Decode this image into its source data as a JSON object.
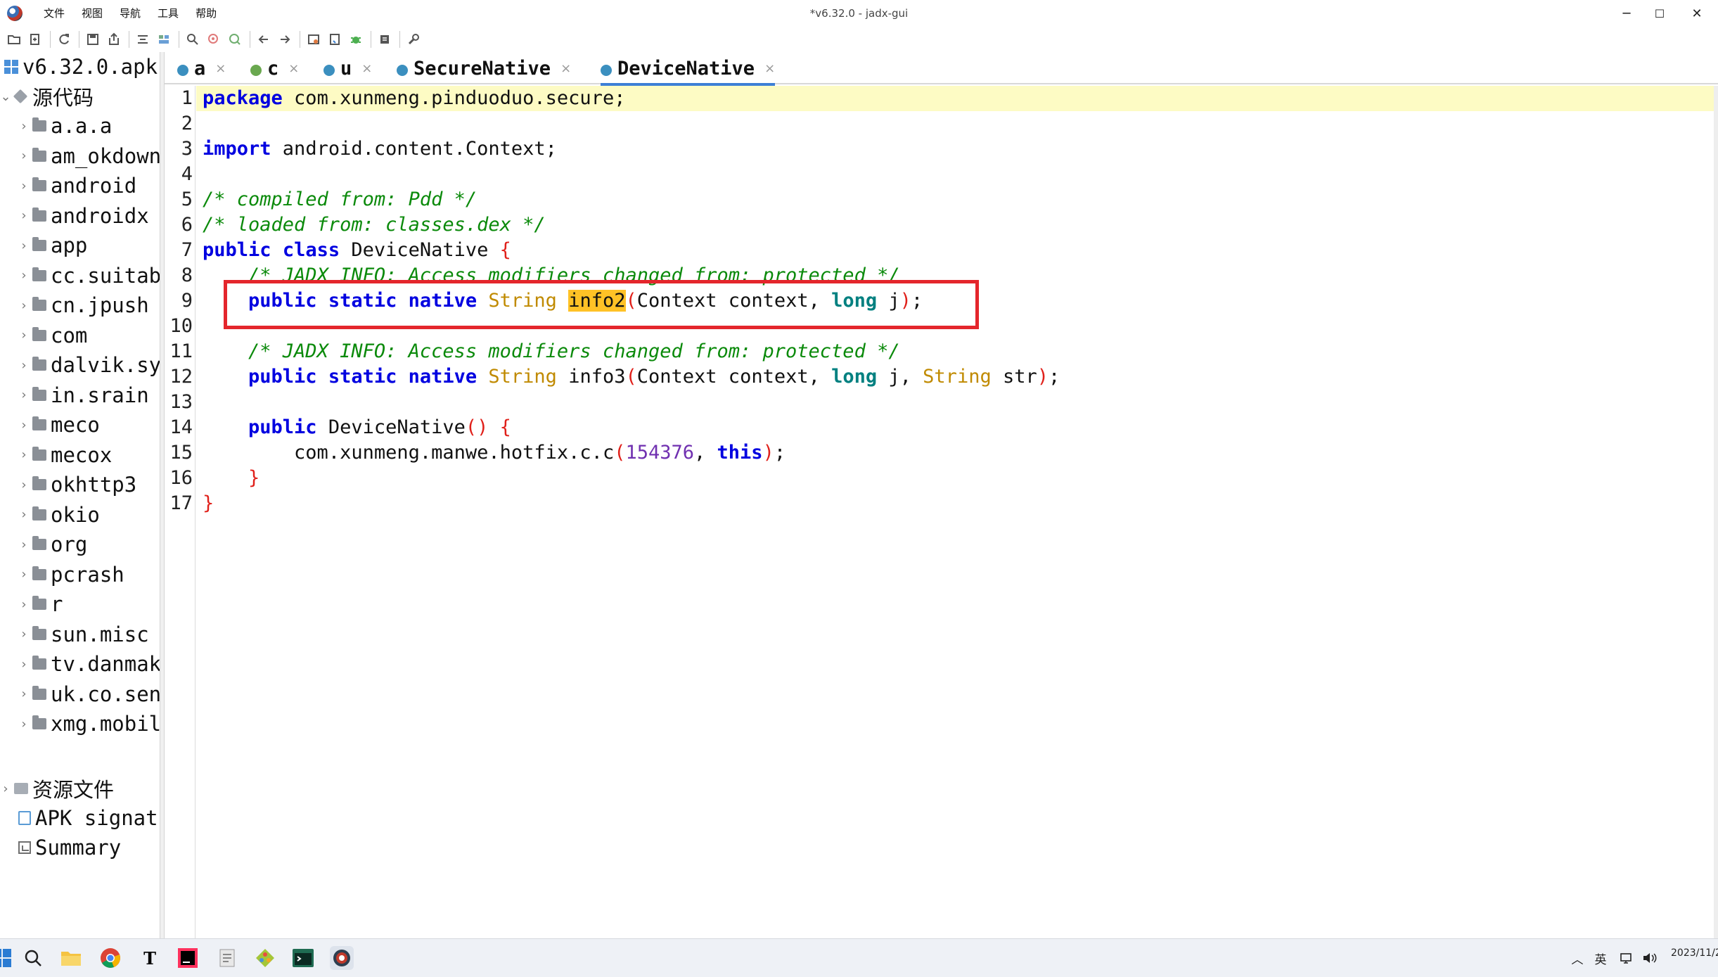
{
  "window": {
    "title": "*v6.32.0 - jadx-gui",
    "minimize": "─",
    "maximize": "☐",
    "close": "✕"
  },
  "menu": [
    "文件",
    "视图",
    "导航",
    "工具",
    "帮助"
  ],
  "toolbar_icons": [
    "open-file-icon",
    "add-files-icon",
    "reload-icon",
    "save-all-icon",
    "export-icon",
    "sync-tree-icon",
    "flat-packages-icon",
    "search-icon",
    "find-usage-icon",
    "goto-icon",
    "back-icon",
    "forward-icon",
    "deobfuscation-icon",
    "quark-icon",
    "debug-icon",
    "log-viewer-icon",
    "preferences-icon"
  ],
  "tree": {
    "root": "v6.32.0.apk",
    "source_node": "源代码",
    "packages": [
      "a.a.a",
      "am_okdown",
      "android",
      "androidx",
      "app",
      "cc.suitab",
      "cn.jpush",
      "com",
      "dalvik.sy",
      "in.srain",
      "meco",
      "mecox",
      "okhttp3",
      "okio",
      "org",
      "pcrash",
      "r",
      "sun.misc",
      "tv.danmak",
      "uk.co.sen",
      "xmg.mobil"
    ],
    "resources_node": "资源文件",
    "apk_signature": "APK signat",
    "summary": "Summary"
  },
  "tabs": [
    {
      "label": "a",
      "icon": "class-icon"
    },
    {
      "label": "c",
      "icon": "interface-icon"
    },
    {
      "label": "u",
      "icon": "class-icon"
    },
    {
      "label": "SecureNative",
      "icon": "class-icon"
    },
    {
      "label": "DeviceNative",
      "icon": "class-icon",
      "active": true
    }
  ],
  "tab_close": "×",
  "code": {
    "line_numbers": [
      "1",
      "2",
      "3",
      "4",
      "5",
      "6",
      "7",
      "8",
      "9",
      "10",
      "11",
      "12",
      "13",
      "14",
      "15",
      "16",
      "17"
    ],
    "l1": {
      "kw": "package",
      "rest": " com.xunmeng.pinduoduo.secure;"
    },
    "l3": {
      "kw": "import",
      "rest": " android.content.Context;"
    },
    "l5": "/* compiled from: Pdd */",
    "l6": "/* loaded from: classes.dex */",
    "l7": {
      "kw1": "public",
      "kw2": "class",
      "name": " DeviceNative ",
      "brace": "{"
    },
    "l8": "/* JADX INFO: Access modifiers changed from: protected */",
    "l9": {
      "mods": "public static native",
      "type": "String",
      "method": "info2",
      "lp": "(",
      "p1": "Context context, ",
      "kw": "long",
      "p2": " j",
      "rp": ")",
      "end": ";"
    },
    "l11": "/* JADX INFO: Access modifiers changed from: protected */",
    "l12": {
      "mods": "public static native",
      "type": "String",
      "method": " info3",
      "lp": "(",
      "p1": "Context context, ",
      "kw": "long",
      "p2": " j, ",
      "type2": "String",
      "p3": " str",
      "rp": ")",
      "end": ";"
    },
    "l14": {
      "kw": "public",
      "name": " DeviceNative",
      "paren": "()",
      "brace": " {"
    },
    "l15": {
      "call": "com.xunmeng.manwe.hotfix.c.c",
      "lp": "(",
      "num": "154376",
      "comma": ", ",
      "kw": "this",
      "rp": ")",
      "end": ";"
    },
    "l16": "}",
    "l17": "}"
  },
  "taskbar": {
    "apps": [
      "start-icon",
      "search-icon",
      "file-explorer-icon",
      "chrome-icon",
      "typora-icon",
      "jetbrains-icon",
      "notepad-icon",
      "git-icon",
      "terminal-icon",
      "jadx-icon"
    ],
    "tray": [
      "chevron-up-icon",
      "ime-icon",
      "network-icon",
      "volume-icon"
    ],
    "ime": "英",
    "clock": "2023/11/2"
  },
  "colors": {
    "keyword": "#0000e0",
    "type": "#c08a00",
    "comment": "#0b8a0b",
    "bracket": "#e0201a",
    "number": "#7030b0",
    "current_line": "#fdfbc4",
    "match_highlight": "#ffc226",
    "annotation_box": "#e4262c"
  }
}
